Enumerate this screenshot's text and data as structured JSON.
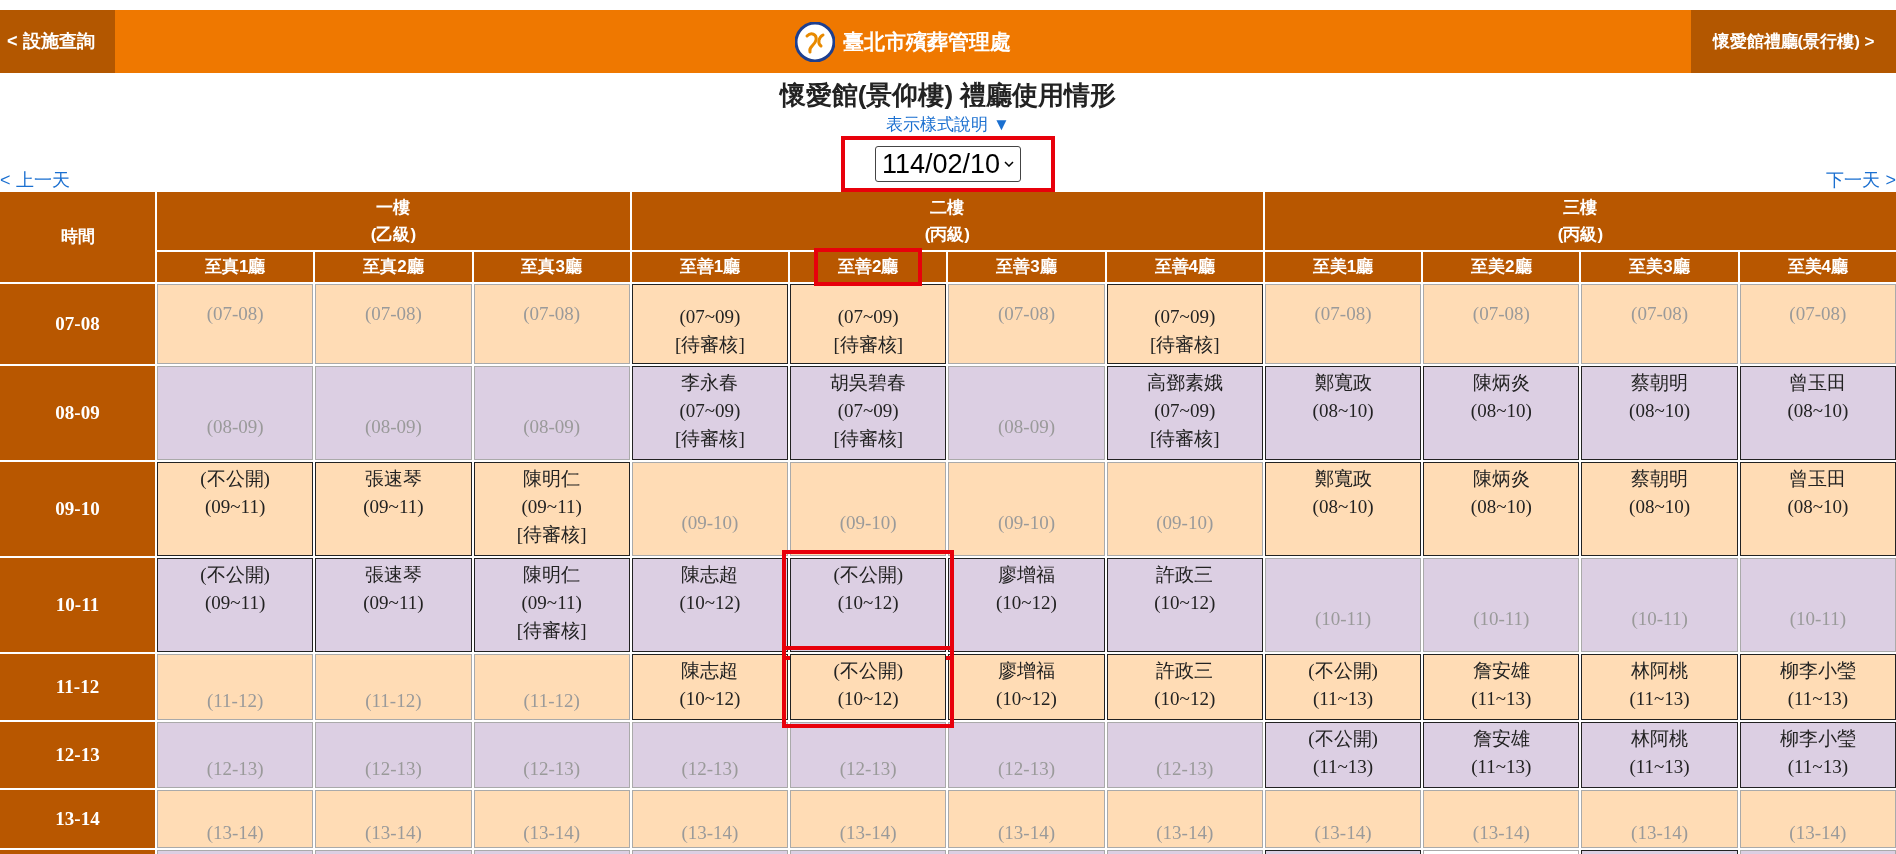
{
  "top_bar": {
    "back_button": "< 設施查詢",
    "title": "臺北市殯葬管理處",
    "next_button": "懷愛館禮廳(景行樓) >"
  },
  "page_title": "懷愛館(景仰樓) 禮廳使用情形",
  "legend_link": "表示樣式說明 ▼",
  "date_select": {
    "value": "114/02/10",
    "highlighted": true
  },
  "prev_day": "< 上一天",
  "next_day": "下一天 >",
  "table": {
    "time_header": "時間",
    "floors": [
      {
        "name": "一樓",
        "grade": "(乙級)",
        "rooms": [
          {
            "label": "至真1廳",
            "highlighted": false
          },
          {
            "label": "至真2廳",
            "highlighted": false
          },
          {
            "label": "至真3廳",
            "highlighted": false
          }
        ]
      },
      {
        "name": "二樓",
        "grade": "(丙級)",
        "rooms": [
          {
            "label": "至善1廳",
            "highlighted": false
          },
          {
            "label": "至善2廳",
            "highlighted": true
          },
          {
            "label": "至善3廳",
            "highlighted": false
          },
          {
            "label": "至善4廳",
            "highlighted": false
          }
        ]
      },
      {
        "name": "三樓",
        "grade": "(丙級)",
        "rooms": [
          {
            "label": "至美1廳",
            "highlighted": false
          },
          {
            "label": "至美2廳",
            "highlighted": false
          },
          {
            "label": "至美3廳",
            "highlighted": false
          },
          {
            "label": "至美4廳",
            "highlighted": false
          }
        ]
      }
    ],
    "rows": [
      {
        "time": "07-08",
        "clipped_top": true,
        "cells": [
          {
            "kind": "empty",
            "range": "(07-08)"
          },
          {
            "kind": "empty",
            "range": "(07-08)"
          },
          {
            "kind": "empty",
            "range": "(07-08)"
          },
          {
            "kind": "booked",
            "range": "(07~09)",
            "status": "[待審核]"
          },
          {
            "kind": "booked",
            "range": "(07~09)",
            "status": "[待審核]"
          },
          {
            "kind": "empty",
            "range": "(07-08)"
          },
          {
            "kind": "booked",
            "range": "(07~09)",
            "status": "[待審核]"
          },
          {
            "kind": "empty",
            "range": "(07-08)"
          },
          {
            "kind": "empty",
            "range": "(07-08)"
          },
          {
            "kind": "empty",
            "range": "(07-08)"
          },
          {
            "kind": "empty",
            "range": "(07-08)"
          }
        ]
      },
      {
        "time": "08-09",
        "clipped_top": false,
        "cells": [
          {
            "kind": "empty",
            "range": "(08-09)"
          },
          {
            "kind": "empty",
            "range": "(08-09)"
          },
          {
            "kind": "empty",
            "range": "(08-09)"
          },
          {
            "kind": "booked",
            "name": "李永春",
            "range": "(07~09)",
            "status": "[待審核]"
          },
          {
            "kind": "booked",
            "name": "胡吳碧春",
            "range": "(07~09)",
            "status": "[待審核]"
          },
          {
            "kind": "empty",
            "range": "(08-09)"
          },
          {
            "kind": "booked",
            "name": "高鄧素娥",
            "range": "(07~09)",
            "status": "[待審核]"
          },
          {
            "kind": "booked",
            "name": "鄭寬政",
            "range": "(08~10)"
          },
          {
            "kind": "booked",
            "name": "陳炳炎",
            "range": "(08~10)"
          },
          {
            "kind": "booked",
            "name": "蔡朝明",
            "range": "(08~10)"
          },
          {
            "kind": "booked",
            "name": "曾玉田",
            "range": "(08~10)"
          }
        ]
      },
      {
        "time": "09-10",
        "clipped_top": false,
        "cells": [
          {
            "kind": "booked",
            "name": "(不公開)",
            "range": "(09~11)"
          },
          {
            "kind": "booked",
            "name": "張速琴",
            "range": "(09~11)"
          },
          {
            "kind": "booked",
            "name": "陳明仁",
            "range": "(09~11)",
            "status": "[待審核]"
          },
          {
            "kind": "empty",
            "range": "(09-10)"
          },
          {
            "kind": "empty",
            "range": "(09-10)"
          },
          {
            "kind": "empty",
            "range": "(09-10)"
          },
          {
            "kind": "empty",
            "range": "(09-10)"
          },
          {
            "kind": "booked",
            "name": "鄭寬政",
            "range": "(08~10)"
          },
          {
            "kind": "booked",
            "name": "陳炳炎",
            "range": "(08~10)"
          },
          {
            "kind": "booked",
            "name": "蔡朝明",
            "range": "(08~10)"
          },
          {
            "kind": "booked",
            "name": "曾玉田",
            "range": "(08~10)"
          }
        ]
      },
      {
        "time": "10-11",
        "clipped_top": false,
        "cells": [
          {
            "kind": "booked",
            "name": "(不公開)",
            "range": "(09~11)"
          },
          {
            "kind": "booked",
            "name": "張速琴",
            "range": "(09~11)"
          },
          {
            "kind": "booked",
            "name": "陳明仁",
            "range": "(09~11)",
            "status": "[待審核]"
          },
          {
            "kind": "booked",
            "name": "陳志超",
            "range": "(10~12)"
          },
          {
            "kind": "booked",
            "name": "(不公開)",
            "range": "(10~12)",
            "highlighted": true
          },
          {
            "kind": "booked",
            "name": "廖增福",
            "range": "(10~12)"
          },
          {
            "kind": "booked",
            "name": "許政三",
            "range": "(10~12)"
          },
          {
            "kind": "empty",
            "range": "(10-11)"
          },
          {
            "kind": "empty",
            "range": "(10-11)"
          },
          {
            "kind": "empty",
            "range": "(10-11)"
          },
          {
            "kind": "empty",
            "range": "(10-11)"
          }
        ]
      },
      {
        "time": "11-12",
        "clipped_top": false,
        "cells": [
          {
            "kind": "empty",
            "range": "(11-12)"
          },
          {
            "kind": "empty",
            "range": "(11-12)"
          },
          {
            "kind": "empty",
            "range": "(11-12)"
          },
          {
            "kind": "booked",
            "name": "陳志超",
            "range": "(10~12)"
          },
          {
            "kind": "booked",
            "name": "(不公開)",
            "range": "(10~12)",
            "highlighted": true
          },
          {
            "kind": "booked",
            "name": "廖增福",
            "range": "(10~12)"
          },
          {
            "kind": "booked",
            "name": "許政三",
            "range": "(10~12)"
          },
          {
            "kind": "booked",
            "name": "(不公開)",
            "range": "(11~13)"
          },
          {
            "kind": "booked",
            "name": "詹安雄",
            "range": "(11~13)"
          },
          {
            "kind": "booked",
            "name": "林阿桃",
            "range": "(11~13)"
          },
          {
            "kind": "booked",
            "name": "柳李小瑩",
            "range": "(11~13)"
          }
        ]
      },
      {
        "time": "12-13",
        "clipped_top": false,
        "cells": [
          {
            "kind": "empty",
            "range": "(12-13)"
          },
          {
            "kind": "empty",
            "range": "(12-13)"
          },
          {
            "kind": "empty",
            "range": "(12-13)"
          },
          {
            "kind": "empty",
            "range": "(12-13)"
          },
          {
            "kind": "empty",
            "range": "(12-13)"
          },
          {
            "kind": "empty",
            "range": "(12-13)"
          },
          {
            "kind": "empty",
            "range": "(12-13)"
          },
          {
            "kind": "booked",
            "name": "(不公開)",
            "range": "(11~13)"
          },
          {
            "kind": "booked",
            "name": "詹安雄",
            "range": "(11~13)"
          },
          {
            "kind": "booked",
            "name": "林阿桃",
            "range": "(11~13)"
          },
          {
            "kind": "booked",
            "name": "柳李小瑩",
            "range": "(11~13)"
          }
        ]
      },
      {
        "time": "13-14",
        "clipped_top": false,
        "cells": [
          {
            "kind": "empty",
            "range": "(13-14)"
          },
          {
            "kind": "empty",
            "range": "(13-14)"
          },
          {
            "kind": "empty",
            "range": "(13-14)"
          },
          {
            "kind": "empty",
            "range": "(13-14)"
          },
          {
            "kind": "empty",
            "range": "(13-14)"
          },
          {
            "kind": "empty",
            "range": "(13-14)"
          },
          {
            "kind": "empty",
            "range": "(13-14)"
          },
          {
            "kind": "empty",
            "range": "(13-14)"
          },
          {
            "kind": "empty",
            "range": "(13-14)"
          },
          {
            "kind": "empty",
            "range": "(13-14)"
          },
          {
            "kind": "empty",
            "range": "(13-14)"
          }
        ]
      },
      {
        "clipped_bottom": true,
        "cells": [
          {
            "kind": "cut"
          },
          {
            "kind": "cut"
          },
          {
            "kind": "cut"
          },
          {
            "kind": "cut"
          },
          {
            "kind": "cut"
          },
          {
            "kind": "cut"
          },
          {
            "kind": "cut"
          },
          {
            "kind": "cut_booked"
          },
          {
            "kind": "cut_blank"
          },
          {
            "kind": "cut_booked"
          },
          {
            "kind": "cut"
          }
        ]
      }
    ]
  }
}
